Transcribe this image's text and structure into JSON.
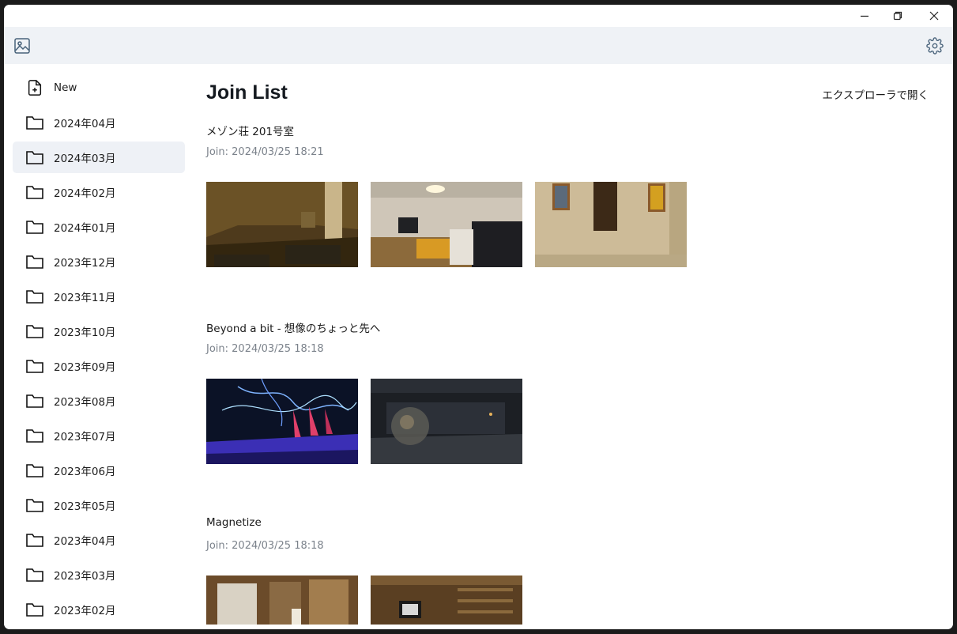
{
  "window": {
    "controls": [
      "minimize-icon",
      "maximize-icon",
      "close-icon"
    ]
  },
  "toolbar": {
    "left_icon": "image-gallery-icon",
    "right_icon": "settings-gear-icon"
  },
  "sidebar": {
    "items": [
      {
        "label": "New",
        "icon": "new-file-icon"
      },
      {
        "label": "2024年04月",
        "icon": "folder-icon"
      },
      {
        "label": "2024年03月",
        "icon": "folder-icon",
        "active": true
      },
      {
        "label": "2024年02月",
        "icon": "folder-icon"
      },
      {
        "label": "2024年01月",
        "icon": "folder-icon"
      },
      {
        "label": "2023年12月",
        "icon": "folder-icon"
      },
      {
        "label": "2023年11月",
        "icon": "folder-icon"
      },
      {
        "label": "2023年10月",
        "icon": "folder-icon"
      },
      {
        "label": "2023年09月",
        "icon": "folder-icon"
      },
      {
        "label": "2023年08月",
        "icon": "folder-icon"
      },
      {
        "label": "2023年07月",
        "icon": "folder-icon"
      },
      {
        "label": "2023年06月",
        "icon": "folder-icon"
      },
      {
        "label": "2023年05月",
        "icon": "folder-icon"
      },
      {
        "label": "2023年04月",
        "icon": "folder-icon"
      },
      {
        "label": "2023年03月",
        "icon": "folder-icon"
      },
      {
        "label": "2023年02月",
        "icon": "folder-icon"
      }
    ]
  },
  "main": {
    "title": "Join List",
    "explorer_link": "エクスプローラで開く",
    "entries": [
      {
        "title": "メゾン荘 201号室",
        "joined": "Join: 2024/03/25 18:21",
        "thumbnails": [
          "dim-tatami-room",
          "lit-apartment-room",
          "hallway-with-portraits"
        ]
      },
      {
        "title": "Beyond a bit - 想像のちょっと先へ",
        "joined": "Join: 2024/03/25 18:18",
        "thumbnails": [
          "neon-blue-lightning",
          "dark-dome-sphere"
        ]
      },
      {
        "title": "Magnetize",
        "joined": "Join: 2024/03/25 18:18",
        "thumbnails": [
          "wooden-bright-room",
          "shelf-room-with-tv"
        ]
      }
    ]
  },
  "colors": {
    "toolbar_bg": "#eff2f6",
    "active_item_bg": "#eef1f6",
    "muted_text": "#7b828b",
    "window_border": "#1b1b1b"
  }
}
